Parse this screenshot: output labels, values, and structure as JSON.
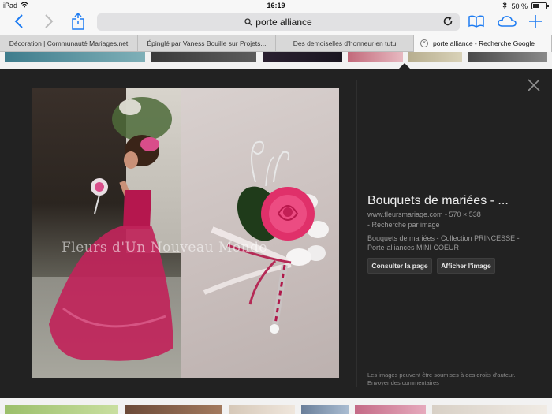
{
  "status": {
    "device": "iPad",
    "time": "16:19",
    "battery": "50 %",
    "battery_level": 0.5
  },
  "toolbar": {
    "address_text": "porte alliance"
  },
  "tabs": [
    {
      "label": "Décoration | Communauté Mariages.net",
      "active": false
    },
    {
      "label": "Épinglé par Vaness Bouille sur Projets...",
      "active": false
    },
    {
      "label": "Des demoiselles d'honneur en tutu",
      "active": false
    },
    {
      "label": "porte alliance - Recherche Google",
      "active": true
    }
  ],
  "preview": {
    "watermark": "Fleurs d'Un Nouveau Monde",
    "title": "Bouquets de mariées - ...",
    "site": "www.fleursmariage.com  -  570 × 538",
    "search_by_image": "-  Recherche par image",
    "description": "Bouquets de mariées - Collection PRINCESSE - Porte-alliances MINI COEUR",
    "visit_button": "Consulter la page",
    "view_button": "Afficher l'image",
    "legal": "Les images peuvent être soumises à des droits d'auteur.",
    "feedback": "Envoyer des commentaires"
  },
  "colors": {
    "accent": "#1e7cf2",
    "panel_bg": "#222222",
    "rose": "#e0306a"
  }
}
